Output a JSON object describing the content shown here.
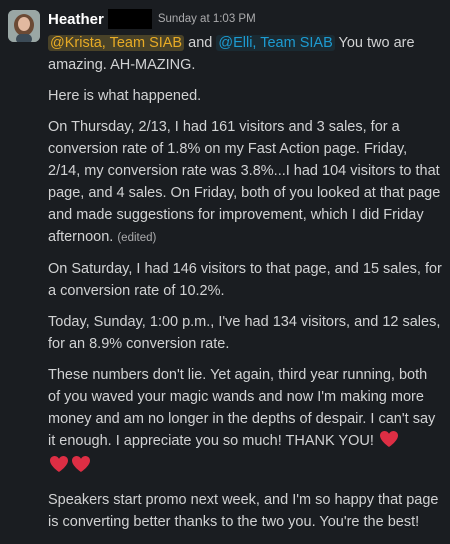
{
  "author": {
    "name": "Heather"
  },
  "timestamp": "Sunday at 1:03 PM",
  "mentions": [
    "@Krista, Team SIAB",
    "@Elli, Team SIAB"
  ],
  "line1": {
    "between": " and ",
    "after": " You two are amazing. AH-MAZING."
  },
  "paragraphs": {
    "p2": "Here is what happened.",
    "p3": "On Thursday, 2/13, I had 161 visitors and 3 sales, for a conversion rate of 1.8% on my Fast Action page. Friday, 2/14, my conversion rate was 3.8%...I had 104 visitors to that page, and 4 sales. On Friday, both of you looked at that page and made suggestions for improvement, which I did Friday afternoon.",
    "p3_edited": "(edited)",
    "p4": "On Saturday, I had 146 visitors to that page, and 15 sales, for a conversion rate of 10.2%.",
    "p5": "Today, Sunday, 1:00 p.m., I've had 134 visitors, and 12 sales, for an 8.9% conversion rate.",
    "p6": "These numbers don't lie. Yet again, third year running, both of you waved your magic wands and now I'm making more money and am no longer in the depths of despair. I can't say it enough. I appreciate you so much! THANK YOU!",
    "p7": "Speakers start promo next week, and I'm so happy that page is converting better thanks to the two you. You're the best!"
  },
  "emoji": {
    "heart_count": 3,
    "name": "red-heart-icon"
  },
  "colors": {
    "background": "#1a1d21",
    "text": "#d1d2d3",
    "mention_highlight": "#e8ab25",
    "mention": "#1d9bd1",
    "heart": "#dd2e44"
  }
}
